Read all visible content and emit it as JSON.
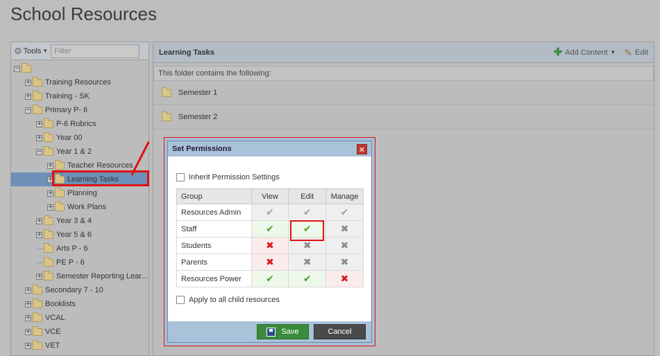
{
  "page": {
    "title": "School Resources"
  },
  "left": {
    "tools_label": "Tools",
    "filter_placeholder": "Filter",
    "tree": [
      {
        "label": "",
        "level": 0,
        "expander": "−"
      },
      {
        "label": "Training Resources",
        "level": 1,
        "expander": "+"
      },
      {
        "label": "Training - SK",
        "level": 1,
        "expander": "+"
      },
      {
        "label": "Primary P- 6",
        "level": 1,
        "expander": "−"
      },
      {
        "label": "P-6 Rubrics",
        "level": 2,
        "expander": "+"
      },
      {
        "label": "Year 00",
        "level": 2,
        "expander": "+"
      },
      {
        "label": "Year 1 & 2",
        "level": 2,
        "expander": "−"
      },
      {
        "label": "Teacher Resources",
        "level": 3,
        "expander": "+"
      },
      {
        "label": "Learning Tasks",
        "level": 3,
        "expander": "+",
        "selected": true
      },
      {
        "label": "Planning",
        "level": 3,
        "expander": "+"
      },
      {
        "label": "Work Plans",
        "level": 3,
        "expander": "+"
      },
      {
        "label": "Year 3 & 4",
        "level": 2,
        "expander": "+"
      },
      {
        "label": "Year 5 & 6",
        "level": 2,
        "expander": "+"
      },
      {
        "label": "Arts P - 6",
        "level": 2,
        "expander": ""
      },
      {
        "label": "PE P - 6",
        "level": 2,
        "expander": ""
      },
      {
        "label": "Semester Reporting Lear...",
        "level": 2,
        "expander": "+"
      },
      {
        "label": "Secondary 7 - 10",
        "level": 1,
        "expander": "+"
      },
      {
        "label": "Booklists",
        "level": 1,
        "expander": "+"
      },
      {
        "label": "VCAL",
        "level": 1,
        "expander": "+"
      },
      {
        "label": "VCE",
        "level": 1,
        "expander": "+"
      },
      {
        "label": "VET",
        "level": 1,
        "expander": "+"
      }
    ]
  },
  "right": {
    "title": "Learning Tasks",
    "add_content": "Add Content",
    "edit": "Edit",
    "contains_text": "This folder contains the following:",
    "items": [
      "Semester 1",
      "Semester 2"
    ]
  },
  "dialog": {
    "title": "Set Permissions",
    "close": "✕",
    "inherit_label": "Inherit Permission Settings",
    "columns": {
      "group": "Group",
      "view": "View",
      "edit": "Edit",
      "manage": "Manage"
    },
    "rows": [
      {
        "group": "Resources Admin",
        "view": "tick-grey",
        "edit": "tick-grey",
        "manage": "tick-grey"
      },
      {
        "group": "Staff",
        "view": "tick-green",
        "edit": "tick-green",
        "manage": "x-grey"
      },
      {
        "group": "Students",
        "view": "x-red",
        "edit": "x-grey",
        "manage": "x-grey"
      },
      {
        "group": "Parents",
        "view": "x-red",
        "edit": "x-grey",
        "manage": "x-grey"
      },
      {
        "group": "Resources Power",
        "view": "tick-green",
        "edit": "tick-green",
        "manage": "x-red"
      }
    ],
    "apply_label": "Apply to all child resources",
    "save_label": "Save",
    "cancel_label": "Cancel"
  },
  "colors": {
    "accent_green": "#3a8b3a",
    "highlight_red": "#e01010",
    "dialog_header": "#a9c1d9",
    "selected_row": "#6e8fb7"
  }
}
